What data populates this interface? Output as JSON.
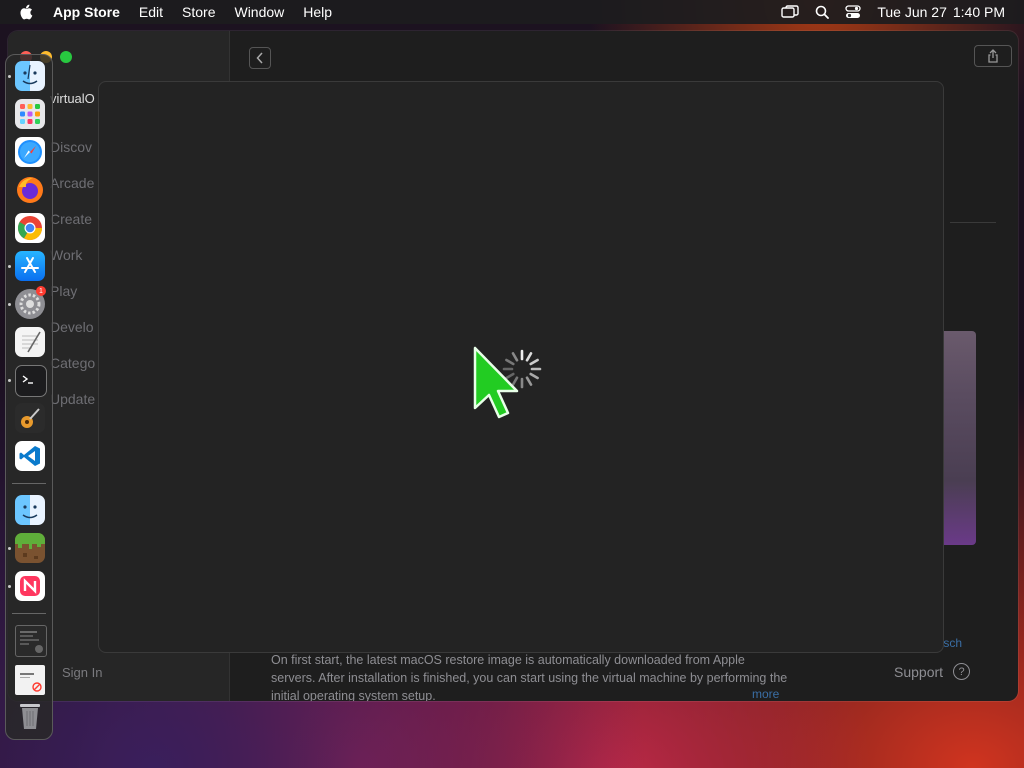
{
  "menubar": {
    "app_name": "App Store",
    "menus": [
      "Edit",
      "Store",
      "Window",
      "Help"
    ],
    "clock_day": "Tue Jun 27",
    "clock_time": "1:40 PM"
  },
  "sidebar": {
    "app_title": "virtualO",
    "items": [
      "Discov",
      "Arcade",
      "Create",
      "Work",
      "Play",
      "Develo",
      "Catego",
      "Update"
    ],
    "sign_in": "Sign In"
  },
  "content": {
    "description": "On first start, the latest macOS restore image is automatically downloaded from Apple servers. After installation is finished, you can start using the virtual machine by performing the initial operating system setup.",
    "more": "more",
    "developer_link": "rtsch",
    "support": "Support",
    "help_glyph": "?"
  },
  "dock": {
    "items": [
      {
        "name": "finder",
        "icon": "finder-icon",
        "running": true
      },
      {
        "name": "launchpad",
        "icon": "launchpad-icon",
        "running": false
      },
      {
        "name": "safari",
        "icon": "safari-icon",
        "running": false
      },
      {
        "name": "firefox",
        "icon": "firefox-icon",
        "running": false
      },
      {
        "name": "chrome",
        "icon": "chrome-icon",
        "running": false
      },
      {
        "name": "app-store",
        "icon": "app-store-icon",
        "running": true
      },
      {
        "name": "system-settings",
        "icon": "gear-icon",
        "running": true,
        "badge": "1"
      },
      {
        "name": "textedit",
        "icon": "textedit-icon",
        "running": false
      },
      {
        "name": "terminal",
        "icon": "terminal-icon",
        "running": true
      },
      {
        "name": "garageband",
        "icon": "guitar-icon",
        "running": false
      },
      {
        "name": "vscode",
        "icon": "vscode-icon",
        "running": false
      },
      {
        "name": "finder-recent",
        "icon": "finder-icon",
        "running": false
      },
      {
        "name": "minecraft",
        "icon": "grass-block-icon",
        "running": true
      },
      {
        "name": "news",
        "icon": "news-icon",
        "running": true
      },
      {
        "name": "screenshot-thumb",
        "icon": "screenshot-icon",
        "running": false
      },
      {
        "name": "document-thumb",
        "icon": "document-icon",
        "running": false
      },
      {
        "name": "trash",
        "icon": "trash-icon",
        "running": false
      }
    ]
  },
  "colors": {
    "accent_green_cursor": "#22cc22",
    "traffic_close": "#fe5f57",
    "traffic_min": "#febc2e",
    "traffic_max": "#28c840"
  }
}
